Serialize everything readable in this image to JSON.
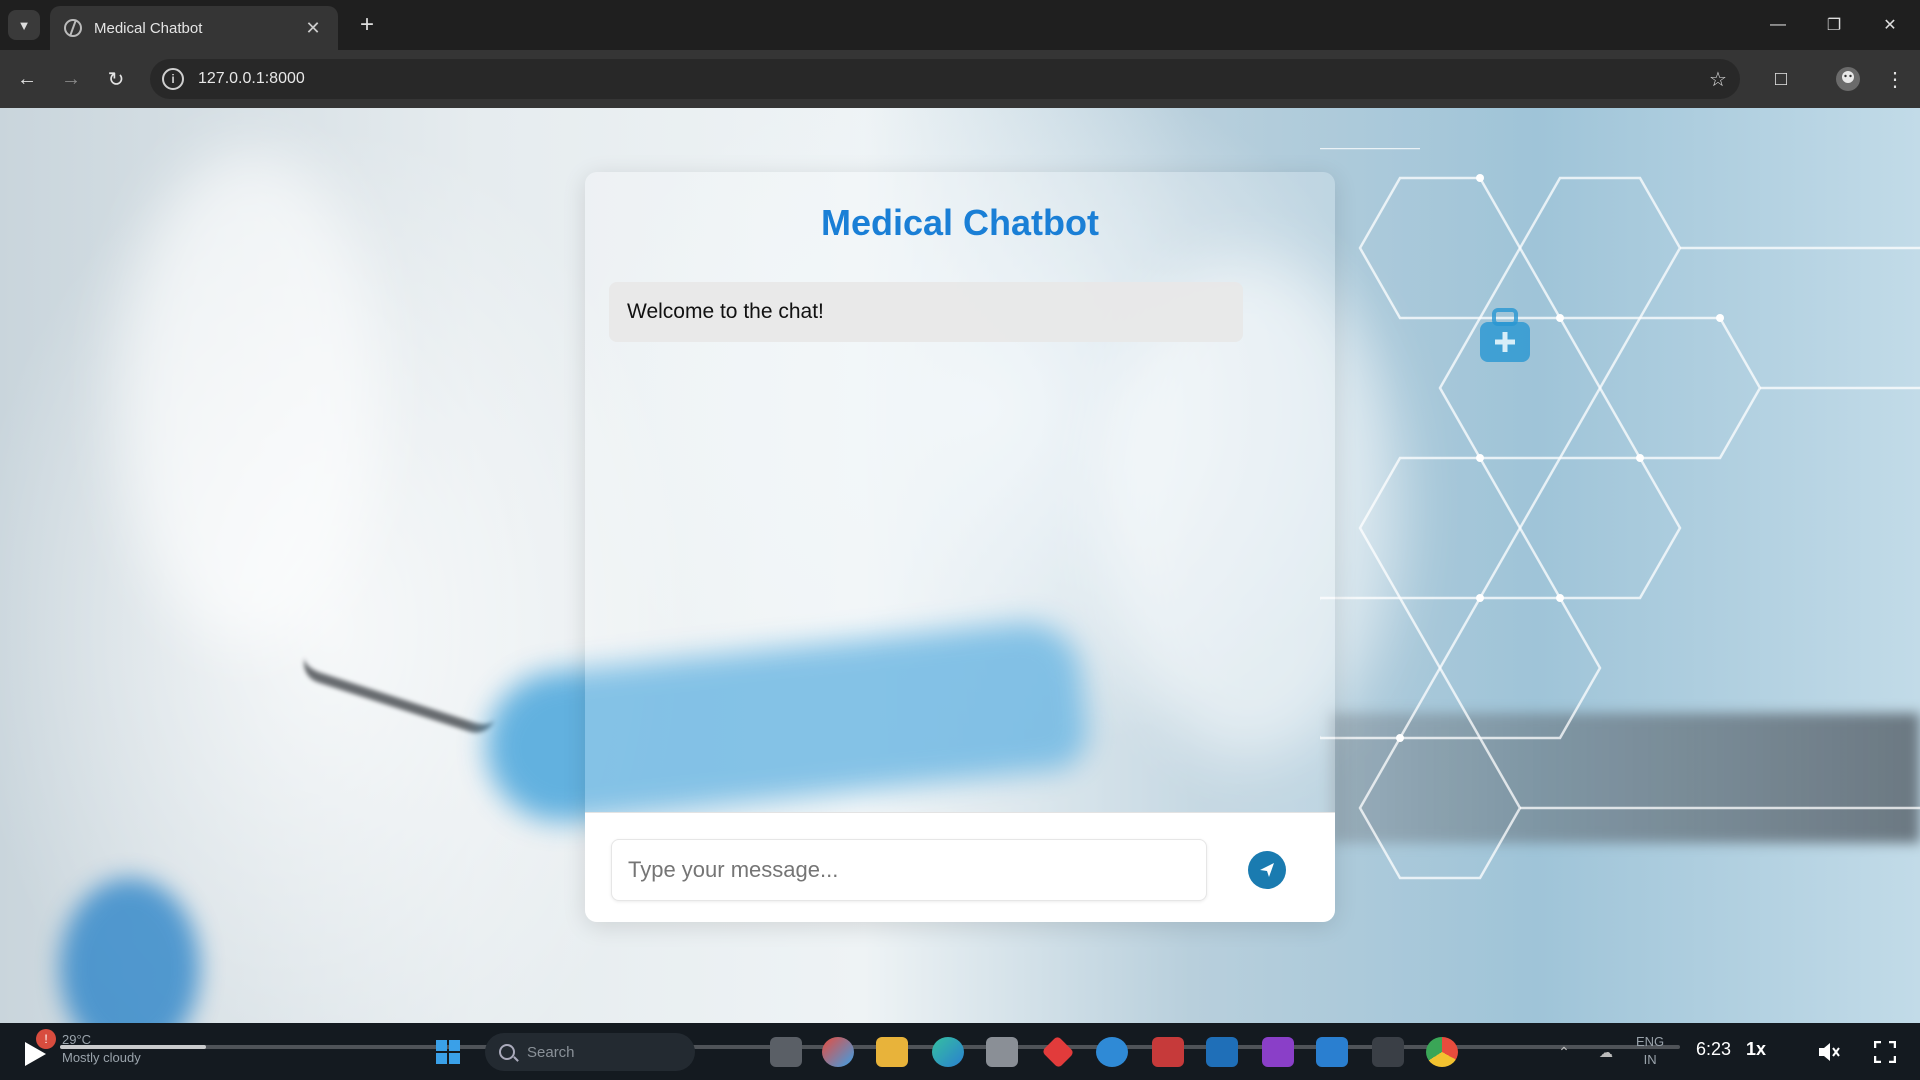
{
  "browser": {
    "tab_title": "Medical Chatbot",
    "url": "127.0.0.1:8000"
  },
  "page": {
    "title": "Medical Chatbot",
    "messages": [
      {
        "sender": "bot",
        "text": "Welcome to the chat!"
      }
    ],
    "input_placeholder": "Type your message...",
    "accent_color": "#1a7fd6",
    "send_button_color": "#1a7bb0"
  },
  "player": {
    "time": "6:23",
    "speed": "1x",
    "progress": 0.09
  },
  "taskbar": {
    "weather_temp": "29°C",
    "weather_desc": "Mostly cloudy",
    "search_label": "Search",
    "lang_top": "ENG",
    "lang_bottom": "IN"
  }
}
